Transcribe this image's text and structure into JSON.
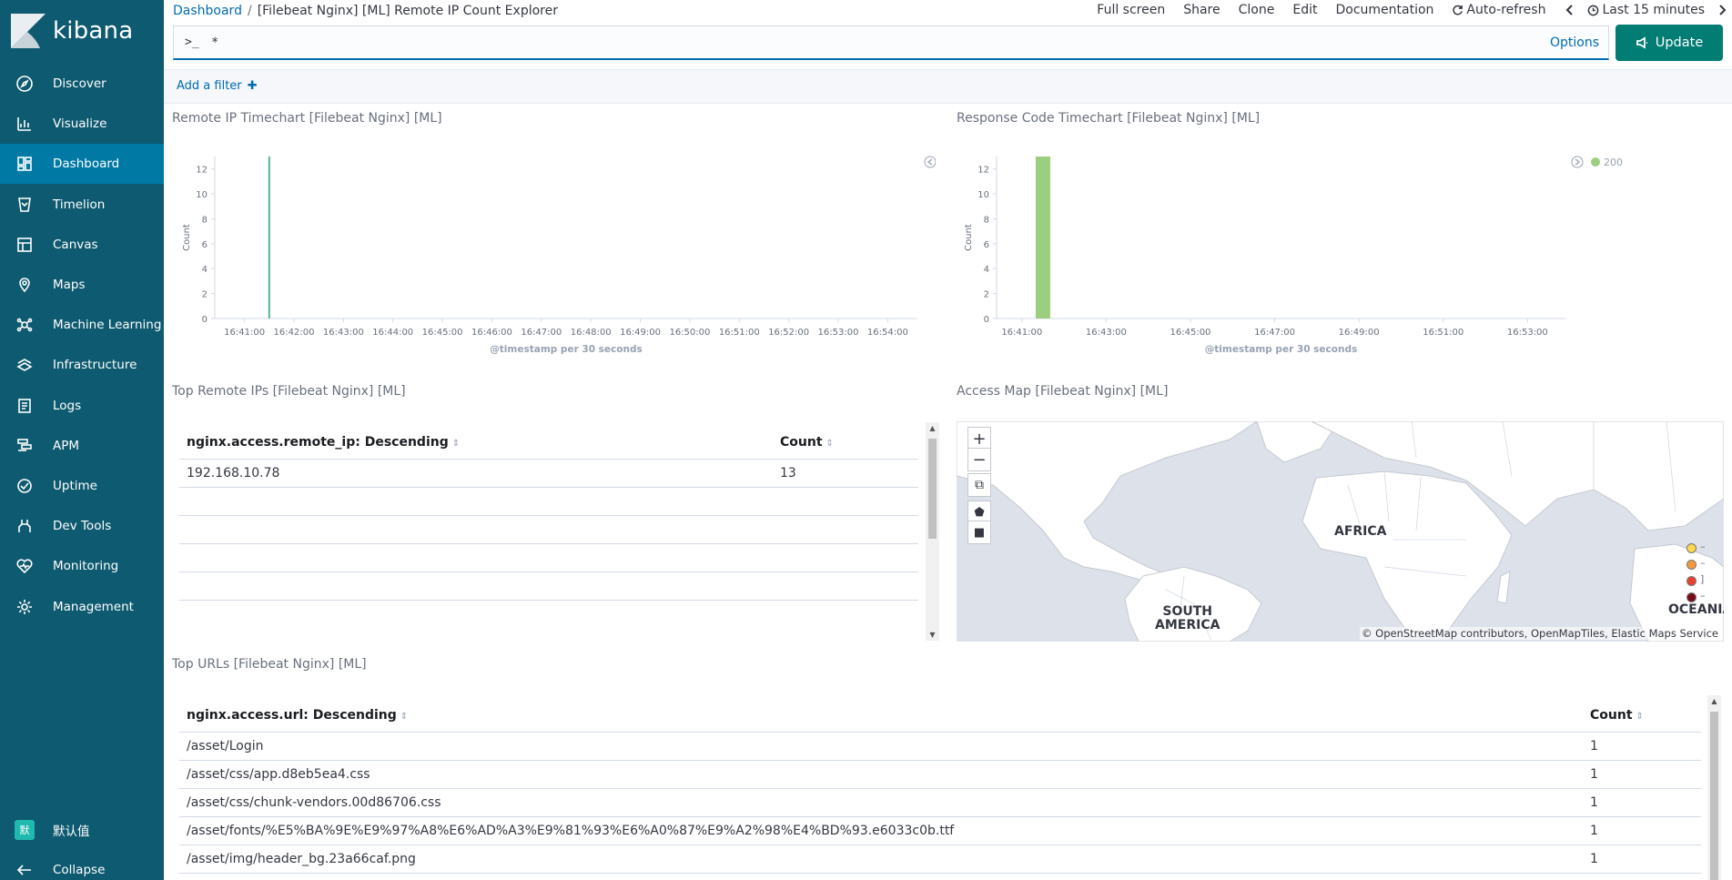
{
  "sidebar": {
    "brand": "kibana",
    "items": [
      {
        "label": "Discover",
        "icon": "compass-icon"
      },
      {
        "label": "Visualize",
        "icon": "visualize-icon"
      },
      {
        "label": "Dashboard",
        "icon": "dashboard-icon",
        "active": true
      },
      {
        "label": "Timelion",
        "icon": "timelion-icon"
      },
      {
        "label": "Canvas",
        "icon": "canvas-icon"
      },
      {
        "label": "Maps",
        "icon": "maps-icon"
      },
      {
        "label": "Machine Learning",
        "icon": "machine-learning-icon"
      },
      {
        "label": "Infrastructure",
        "icon": "infrastructure-icon"
      },
      {
        "label": "Logs",
        "icon": "logs-icon"
      },
      {
        "label": "APM",
        "icon": "apm-icon"
      },
      {
        "label": "Uptime",
        "icon": "uptime-icon"
      },
      {
        "label": "Dev Tools",
        "icon": "dev-tools-icon"
      },
      {
        "label": "Monitoring",
        "icon": "monitoring-icon"
      },
      {
        "label": "Management",
        "icon": "gear-icon"
      }
    ],
    "user": {
      "initial": "默",
      "label": "默认值"
    },
    "collapse_label": "Collapse"
  },
  "header": {
    "breadcrumb_root": "Dashboard",
    "breadcrumb_current": "[Filebeat Nginx] [ML] Remote IP Count Explorer",
    "menu": {
      "full_screen": "Full screen",
      "share": "Share",
      "clone": "Clone",
      "edit": "Edit",
      "documentation": "Documentation",
      "auto_refresh": "Auto-refresh",
      "time_range": "Last 15 minutes"
    }
  },
  "query": {
    "prompt": ">_",
    "value": "*",
    "options_label": "Options",
    "update_label": "Update"
  },
  "filter": {
    "add_label": "Add a filter"
  },
  "panels": {
    "remote_ip_timechart": {
      "title": "Remote IP Timechart [Filebeat Nginx] [ML]"
    },
    "response_code_timechart": {
      "title": "Response Code Timechart [Filebeat Nginx] [ML]"
    },
    "top_remote_ips": {
      "title": "Top Remote IPs [Filebeat Nginx] [ML]",
      "columns": [
        "nginx.access.remote_ip: Descending",
        "Count"
      ],
      "rows": [
        [
          "192.168.10.78",
          "13"
        ]
      ]
    },
    "access_map": {
      "title": "Access Map [Filebeat Nginx] [ML]",
      "labels": {
        "africa": "AFRICA",
        "south_america": "SOUTH\nAMERICA",
        "oceania": "OCEANIA"
      },
      "attribution": "© OpenStreetMap contributors, OpenMapTiles, Elastic Maps Service",
      "legend_colors": [
        "#fdd84f",
        "#f59a3a",
        "#e8412d",
        "#7a0a1a"
      ],
      "legend_values": [
        "–",
        "–",
        "]",
        "–"
      ]
    },
    "top_urls": {
      "title": "Top URLs [Filebeat Nginx] [ML]",
      "columns": [
        "nginx.access.url: Descending",
        "Count"
      ],
      "rows": [
        [
          "/asset/Login",
          "1"
        ],
        [
          "/asset/css/app.d8eb5ea4.css",
          "1"
        ],
        [
          "/asset/css/chunk-vendors.00d86706.css",
          "1"
        ],
        [
          "/asset/fonts/%E5%BA%9E%E9%97%A8%E6%AD%A3%E9%81%93%E6%A0%87%E9%A2%98%E4%BD%93.e6033c0b.ttf",
          "1"
        ],
        [
          "/asset/img/header_bg.23a66caf.png",
          "1"
        ]
      ]
    }
  },
  "chart_data": [
    {
      "type": "bar",
      "name": "remote-ip-timechart",
      "ylabel": "Count",
      "xlabel": "@timestamp per 30 seconds",
      "ylim": [
        0,
        13
      ],
      "yticks": [
        0,
        2,
        4,
        6,
        8,
        10,
        12
      ],
      "xticks": [
        "16:41:00",
        "16:42:00",
        "16:43:00",
        "16:44:00",
        "16:45:00",
        "16:46:00",
        "16:47:00",
        "16:48:00",
        "16:49:00",
        "16:50:00",
        "16:51:00",
        "16:52:00",
        "16:53:00",
        "16:54:00"
      ],
      "x": [
        "16:41:30"
      ],
      "values": [
        13
      ],
      "color": "#54b399"
    },
    {
      "type": "bar",
      "name": "response-code-timechart",
      "ylabel": "Count",
      "xlabel": "@timestamp per 30 seconds",
      "ylim": [
        0,
        13
      ],
      "yticks": [
        0,
        2,
        4,
        6,
        8,
        10,
        12
      ],
      "xticks": [
        "16:41:00",
        "16:43:00",
        "16:45:00",
        "16:47:00",
        "16:49:00",
        "16:51:00",
        "16:53:00"
      ],
      "series": [
        {
          "name": "200",
          "x": [
            "16:41:30"
          ],
          "values": [
            13
          ]
        }
      ],
      "color": "#9bcf7f"
    }
  ]
}
